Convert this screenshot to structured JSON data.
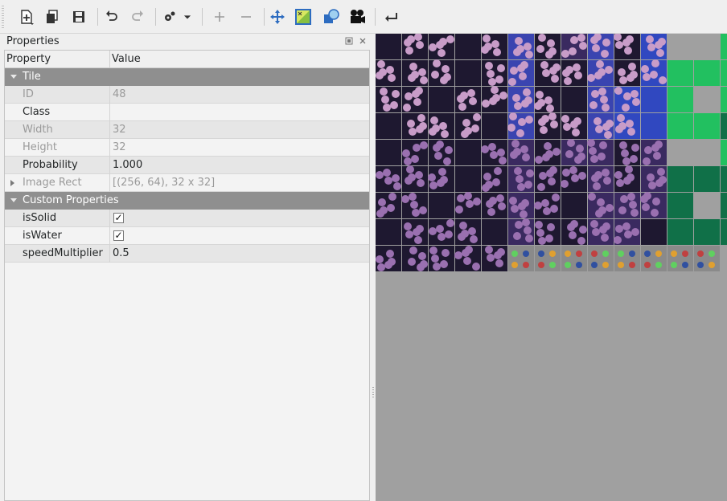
{
  "toolbar": {
    "items": [
      {
        "name": "new-tileset-icon"
      },
      {
        "name": "embed-tileset-icon"
      },
      {
        "name": "save-icon"
      },
      {
        "name": "undo-icon"
      },
      {
        "name": "redo-icon"
      },
      {
        "name": "terrain-dropdown-icon"
      },
      {
        "name": "add-property-icon"
      },
      {
        "name": "remove-property-icon"
      },
      {
        "name": "dynamic-wrapping-icon"
      },
      {
        "name": "edit-terrain-icon"
      },
      {
        "name": "edit-collision-icon"
      },
      {
        "name": "edit-animation-icon"
      },
      {
        "name": "show-tileset-info-icon"
      }
    ]
  },
  "properties_panel": {
    "title": "Properties",
    "columns": {
      "property": "Property",
      "value": "Value"
    },
    "tile_group": "Tile",
    "rows": {
      "id": {
        "label": "ID",
        "value": "48"
      },
      "class": {
        "label": "Class",
        "value": ""
      },
      "width": {
        "label": "Width",
        "value": "32"
      },
      "height": {
        "label": "Height",
        "value": "32"
      },
      "probability": {
        "label": "Probability",
        "value": "1.000"
      },
      "image_rect": {
        "label": "Image Rect",
        "value": "[(256, 64), 32 x 32]"
      }
    },
    "custom_group": "Custom Properties",
    "custom": {
      "is_solid": {
        "label": "isSolid",
        "checked": true
      },
      "is_water": {
        "label": "isWater",
        "checked": true
      },
      "speed_multiplier": {
        "label": "speedMultiplier",
        "value": "0.5"
      }
    },
    "checkmark": "✓"
  },
  "colors": {
    "canvas_bg": "#a0a0a0",
    "group_row": "#8f8f8f",
    "cave_dark": "#1e1830",
    "cave_rock": "#c89cc8",
    "cave_blue": "#3048c0",
    "grass_bright": "#22c060",
    "grass_dark": "#107048"
  }
}
